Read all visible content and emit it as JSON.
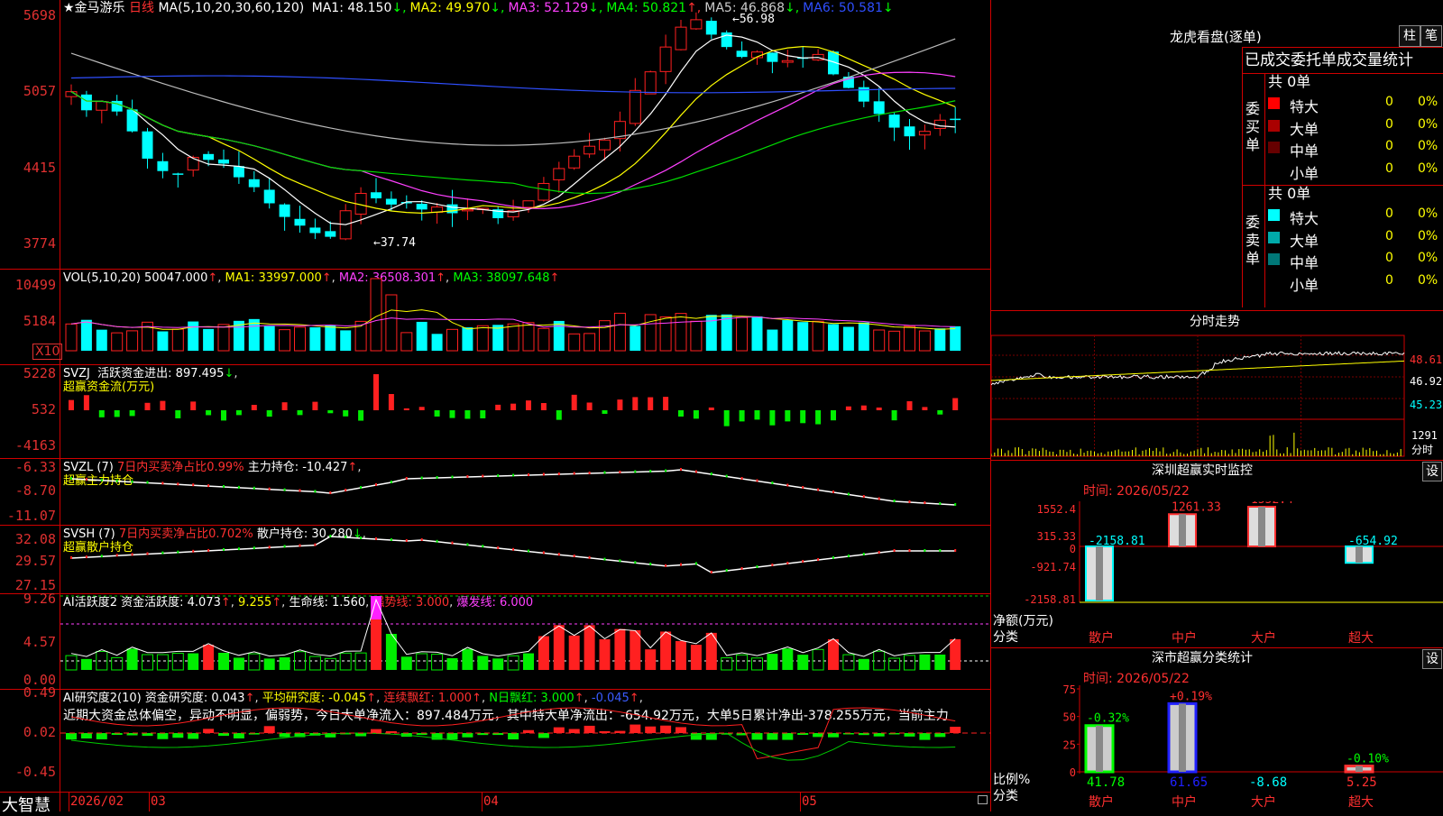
{
  "main": {
    "stock_name": "★金马游乐",
    "period": "日线",
    "ma_legend": "MA(5,10,20,30,60,120)",
    "ma_items": [
      {
        "label": "MA1:",
        "value": "48.150",
        "arrow": "↓",
        "color": "#ffffff"
      },
      {
        "label": "MA2:",
        "value": "49.970",
        "arrow": "↓",
        "color": "#ffff00"
      },
      {
        "label": "MA3:",
        "value": "52.129",
        "arrow": "↓",
        "color": "#ff40ff"
      },
      {
        "label": "MA4:",
        "value": "50.821",
        "arrow": "↑",
        "color": "#00ff00"
      },
      {
        "label": "MA5:",
        "value": "46.868",
        "arrow": "↓",
        "color": "#cccccc"
      },
      {
        "label": "MA6:",
        "value": "50.581",
        "arrow": "↓",
        "color": "#2f4fff"
      }
    ],
    "y_labels": [
      "5698",
      "5057",
      "4415",
      "3774"
    ],
    "high_marker": "56.98",
    "low_marker": "37.74",
    "colors": {
      "up": "#ff2020",
      "down": "#00ffff",
      "ma1": "#ffffff",
      "ma2": "#ffff00",
      "ma3": "#ff40ff",
      "ma4": "#00dd00",
      "ma5": "#bbbbbb",
      "ma6": "#2f4fff",
      "grid": "#d00000"
    }
  },
  "vol": {
    "legend": "VOL(5,10,20)",
    "value": "50047.000",
    "ma1": "33997.000",
    "ma2": "36508.301",
    "ma3": "38097.648",
    "y_labels": [
      "10499",
      "5184"
    ],
    "unit": "X10"
  },
  "svzj": {
    "name": "SVZJ",
    "line1": "活跃资金进出: 897.495",
    "line2": "超赢资金流(万元)",
    "y_labels": [
      "5228",
      "532",
      "-4163"
    ]
  },
  "svzl": {
    "name": "SVZL (7)",
    "ratio_label": "7日内买卖净占比0.99%",
    "hold_label": "主力持仓: -10.427",
    "line2": "超赢主力持仓",
    "y_labels": [
      "-6.33",
      "-8.70",
      "-11.07"
    ]
  },
  "svsh": {
    "name": "SVSH (7)",
    "ratio_label": "7日内买卖净占比0.702%",
    "hold_label": "散户持仓: 30.280",
    "line2": "超赢散户持仓",
    "y_labels": [
      "32.08",
      "29.57",
      "27.15"
    ]
  },
  "ai2": {
    "name": "AI活跃度2",
    "main_label": "资金活跃度: 4.073",
    "v2": "9.255",
    "life_label": "生命线: 1.560",
    "strong_label": "强势线: 3.000",
    "burst_label": "爆发线: 6.000",
    "y_labels": [
      "9.26",
      "4.57",
      "0.00"
    ]
  },
  "ai3": {
    "name": "AI研究度2(10)",
    "research_label": "资金研究度: 0.043",
    "avg_label": "平均研究度: -0.045",
    "streak_label": "连续飘红: 1.000",
    "nday_label": "N日飘红: 3.000",
    "last_value": "-0.045",
    "summary": "近期大资金总体偏空，异动不明显，偏弱势，今日大单净流入：897.484万元，其中特大单净流出：-654.92万元，大单5日累计净出-378.255万元，当前主力",
    "y_labels": [
      "0.49",
      "0.02",
      "-0.45"
    ]
  },
  "bottom": {
    "brand": "大智慧",
    "dates": [
      "2026/02",
      "03",
      "04",
      "05"
    ]
  },
  "right": {
    "lhb_title": "龙虎看盘(逐单)",
    "btn_zhu": "柱",
    "btn_bi": "笔",
    "table_header": "已成交委托单成交量统计",
    "buy_title": "委买单",
    "sell_title": "委卖单",
    "buy_total": "共 0单",
    "sell_total": "共 0单",
    "buy_rows": [
      {
        "label": "特大",
        "count": "0",
        "pct": "0%",
        "color": "#ff0000"
      },
      {
        "label": "大单",
        "count": "0",
        "pct": "0%",
        "color": "#aa0000"
      },
      {
        "label": "中单",
        "count": "0",
        "pct": "0%",
        "color": "#660000"
      },
      {
        "label": "小单",
        "count": "0",
        "pct": "0%",
        "color": ""
      }
    ],
    "sell_rows": [
      {
        "label": "特大",
        "count": "0",
        "pct": "0%",
        "color": "#00ffff"
      },
      {
        "label": "大单",
        "count": "0",
        "pct": "0%",
        "color": "#00aaaa"
      },
      {
        "label": "中单",
        "count": "0",
        "pct": "0%",
        "color": "#007777"
      },
      {
        "label": "小单",
        "count": "0",
        "pct": "0%",
        "color": ""
      }
    ],
    "fenshi_title": "分时走势",
    "fenshi_y": [
      "48.61",
      "46.92",
      "45.23"
    ],
    "fenshi_vol": "1291",
    "fenshi_unit": "分时",
    "monitor_title": "深圳超赢实时监控",
    "monitor_btn": "设",
    "monitor_time": "时间: 2026/05/22",
    "monitor_y": [
      "1552.4",
      "315.33",
      "0",
      "-921.74",
      "-2158.81"
    ],
    "monitor_values": [
      {
        "cat": "散户",
        "value": -2158.81,
        "label": "-2158.81"
      },
      {
        "cat": "中户",
        "value": 1261.33,
        "label": "1261.33"
      },
      {
        "cat": "大户",
        "value": 1552.4,
        "label": "1552.4"
      },
      {
        "cat": "超大",
        "value": -654.92,
        "label": "-654.92"
      }
    ],
    "monitor_ylabel": "净额(万元)",
    "monitor_xlabel": "分类",
    "stat_title": "深市超赢分类统计",
    "stat_btn": "设",
    "stat_time": "时间: 2026/05/22",
    "stat_y": [
      "75",
      "50",
      "25",
      "0"
    ],
    "stat_bars": [
      {
        "cat": "散户",
        "ratio": 41.78,
        "ratio_label": "41.78",
        "change": "-0.32%",
        "color": "#00ff00"
      },
      {
        "cat": "中户",
        "ratio": 61.65,
        "ratio_label": "61.65",
        "change": "+0.19%",
        "color": "#2020ff"
      },
      {
        "cat": "大户",
        "ratio": -8.68,
        "ratio_label": "-8.68",
        "change": "",
        "color": "#00ffff"
      },
      {
        "cat": "超大",
        "ratio": 5.25,
        "ratio_label": "5.25",
        "change": "-0.10%",
        "color": "#ff3030"
      }
    ],
    "stat_ylabel": "比例%",
    "stat_xlabel": "分类"
  }
}
